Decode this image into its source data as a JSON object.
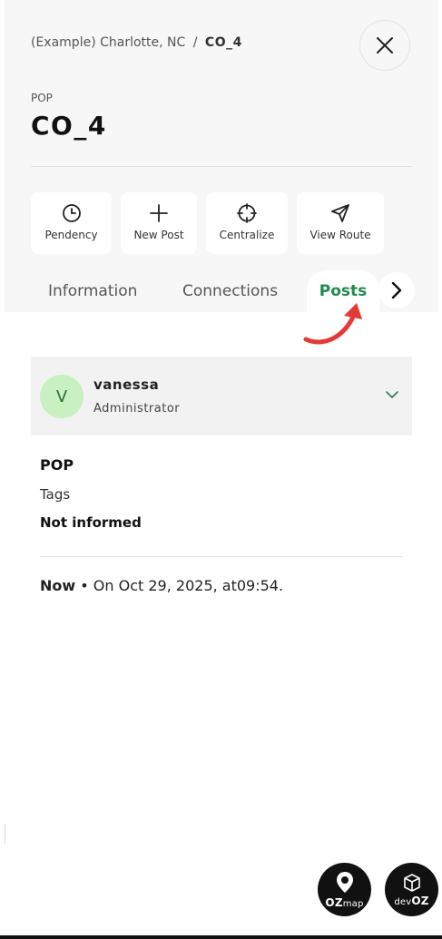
{
  "header": {
    "breadcrumb_location": "(Example) Charlotte, NC",
    "breadcrumb_separator": "/",
    "breadcrumb_current": "CO_4",
    "close_icon": "close-icon"
  },
  "entity": {
    "type_label": "POP",
    "title": "CO_4"
  },
  "actions": [
    {
      "label": "Pendency",
      "icon": "clock-icon"
    },
    {
      "label": "New Post",
      "icon": "plus-icon"
    },
    {
      "label": "Centralize",
      "icon": "crosshair-icon"
    },
    {
      "label": "View Route",
      "icon": "navigation-icon"
    }
  ],
  "tabs": [
    {
      "label": "Information",
      "active": false
    },
    {
      "label": "Connections",
      "active": false
    },
    {
      "label": "Posts",
      "active": true
    }
  ],
  "post": {
    "avatar_initial": "V",
    "author_name": "vanessa",
    "author_role": "Administrator",
    "type": "POP",
    "tags_label": "Tags",
    "tags_value": "Not informed",
    "time_now": "Now",
    "time_bullet": "•",
    "time_text": "On Oct 29, 2025, at09:54."
  },
  "branding": [
    {
      "text_prefix": "OZ",
      "text_suffix": "map"
    },
    {
      "text_prefix": "dev",
      "text_suffix": "OZ"
    }
  ],
  "colors": {
    "accent_green": "#1f8a4c",
    "avatar_bg": "#c8f0c0",
    "annotation_red": "#e53935"
  }
}
